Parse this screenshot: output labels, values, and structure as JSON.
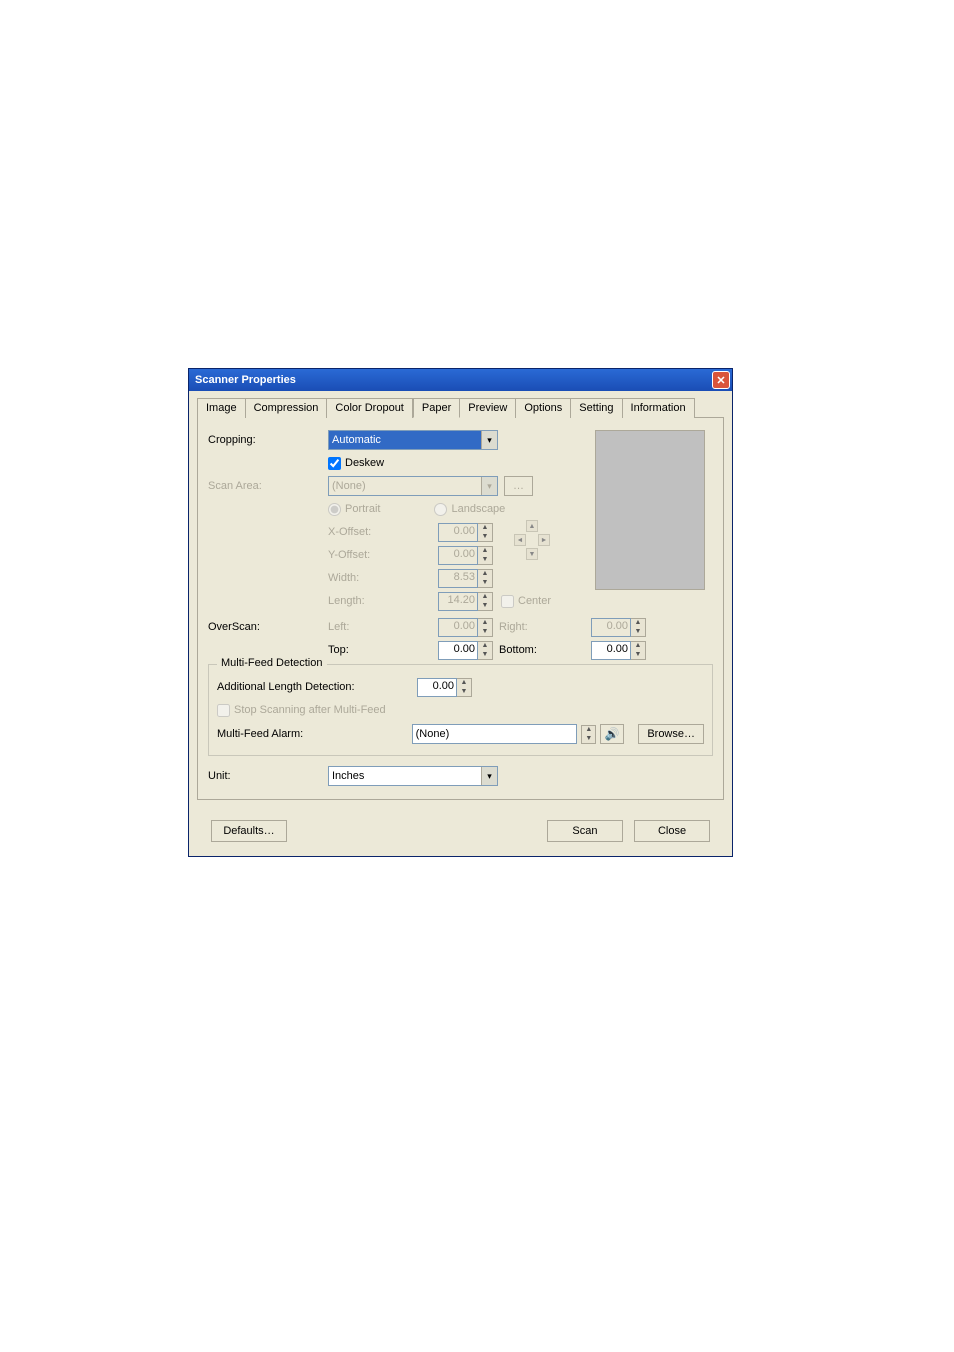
{
  "window": {
    "title": "Scanner Properties"
  },
  "tabs": {
    "image": "Image",
    "compression": "Compression",
    "colorDropout": "Color Dropout",
    "paper": "Paper",
    "preview": "Preview",
    "options": "Options",
    "setting": "Setting",
    "information": "Information"
  },
  "labels": {
    "cropping": "Cropping:",
    "deskew": "Deskew",
    "scanArea": "Scan Area:",
    "portrait": "Portrait",
    "landscape": "Landscape",
    "xoffset": "X-Offset:",
    "yoffset": "Y-Offset:",
    "width": "Width:",
    "length": "Length:",
    "center": "Center",
    "overscan": "OverScan:",
    "left": "Left:",
    "right": "Right:",
    "top": "Top:",
    "bottom": "Bottom:",
    "multiFeedDetection": "Multi-Feed Detection",
    "addLengthDetection": "Additional Length Detection:",
    "stopAfterMF": "Stop Scanning after Multi-Feed",
    "mfAlarm": "Multi-Feed Alarm:",
    "unit": "Unit:",
    "browseEllipsis": "…"
  },
  "values": {
    "cropping": "Automatic",
    "scanArea": "(None)",
    "xoffset": "0.00",
    "yoffset": "0.00",
    "width": "8.53",
    "length": "14.20",
    "overscanLeft": "0.00",
    "overscanRight": "0.00",
    "overscanTop": "0.00",
    "overscanBottom": "0.00",
    "addLength": "0.00",
    "mfAlarm": "(None)",
    "unit": "Inches"
  },
  "buttons": {
    "defaults": "Defaults…",
    "scan": "Scan",
    "close": "Close",
    "browse": "Browse…"
  }
}
